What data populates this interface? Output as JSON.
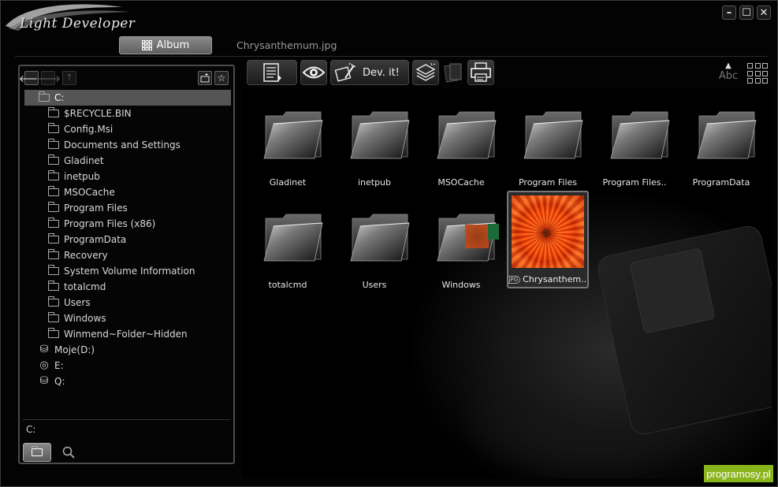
{
  "app": {
    "title": "Light Developer",
    "window_controls": [
      "minimize",
      "maximize",
      "close"
    ]
  },
  "tabs": {
    "album_label": "Album",
    "file_label": "Chrysanthemum.jpg"
  },
  "tree": {
    "root": "C:",
    "folders": [
      "$RECYCLE.BIN",
      "Config.Msi",
      "Documents and Settings",
      "Gladinet",
      "inetpub",
      "MSOCache",
      "Program Files",
      "Program Files (x86)",
      "ProgramData",
      "Recovery",
      "System Volume Information",
      "totalcmd",
      "Users",
      "Windows",
      "Winmend~Folder~Hidden"
    ],
    "drives": [
      {
        "label": "Moje(D:)",
        "icon": "hard-drive-icon"
      },
      {
        "label": "E:",
        "icon": "cd-drive-icon"
      },
      {
        "label": "Q:",
        "icon": "hard-drive-icon"
      }
    ],
    "current_path": "C:"
  },
  "toolbar": {
    "dev_label": "Dev. it!",
    "sort_label": "Abc"
  },
  "content": {
    "folders": [
      "Gladinet",
      "inetpub",
      "MSOCache",
      "Program Files",
      "Program Files..",
      "ProgramData",
      "totalcmd",
      "Users",
      "Windows"
    ],
    "image": {
      "label": "Chrysanthem...",
      "type_tag": "JPG"
    }
  },
  "brand": "programosy.pl",
  "colors": {
    "background": "#000000",
    "selected_tab": "#7a7a7a",
    "brand_green": "#8ab41c"
  }
}
